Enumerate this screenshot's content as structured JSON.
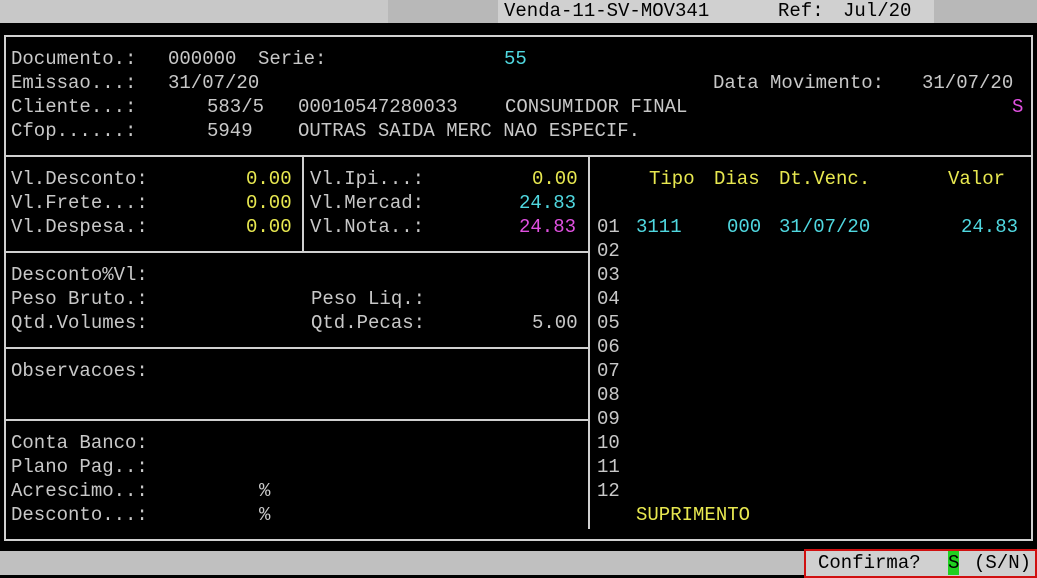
{
  "title_bar": {
    "program": "Venda-11-SV-MOV341",
    "ref_label": "Ref:",
    "ref_value": "Jul/20"
  },
  "header": {
    "documento_label": "Documento.:",
    "documento_value": "000000",
    "serie_label": "Serie:",
    "serie_value": "55",
    "emissao_label": "Emissao...:",
    "emissao_value": "31/07/20",
    "data_movimento_label": "Data Movimento:",
    "data_movimento_value": "31/07/20",
    "cliente_label": "Cliente...:",
    "cliente_code": "583/5",
    "cliente_doc": "00010547280033",
    "cliente_name": "CONSUMIDOR FINAL",
    "cliente_flag": "S",
    "cfop_label": "Cfop......:",
    "cfop_code": "5949",
    "cfop_desc": "OUTRAS SAIDA MERC NAO ESPECIF."
  },
  "values": {
    "vl_desconto_label": "Vl.Desconto:",
    "vl_desconto": "0.00",
    "vl_frete_label": "Vl.Frete...:",
    "vl_frete": "0.00",
    "vl_despesa_label": "Vl.Despesa.:",
    "vl_despesa": "0.00",
    "vl_ipi_label": "Vl.Ipi...:",
    "vl_ipi": "0.00",
    "vl_mercad_label": "Vl.Mercad:",
    "vl_mercad": "24.83",
    "vl_nota_label": "Vl.Nota..:",
    "vl_nota": "24.83"
  },
  "extra": {
    "desconto_pct_label": "Desconto%Vl:",
    "peso_bruto_label": "Peso Bruto.:",
    "peso_liq_label": "Peso Liq.:",
    "qtd_volumes_label": "Qtd.Volumes:",
    "qtd_pecas_label": "Qtd.Pecas:",
    "qtd_pecas_value": "5.00",
    "observacoes_label": "Observacoes:"
  },
  "payment": {
    "conta_banco_label": "Conta Banco:",
    "plano_pag_label": "Plano Pag..:",
    "acrescimo_label": "Acrescimo..:",
    "acrescimo_pct": "%",
    "desconto_label": "Desconto...:",
    "desconto_pct": "%"
  },
  "installments": {
    "headers": {
      "tipo": "Tipo",
      "dias": "Dias",
      "dt_venc": "Dt.Venc.",
      "valor": "Valor"
    },
    "rows": [
      {
        "n": "01",
        "tipo": "3111",
        "dias": "000",
        "dt_venc": "31/07/20",
        "valor": "24.83"
      },
      {
        "n": "02"
      },
      {
        "n": "03"
      },
      {
        "n": "04"
      },
      {
        "n": "05"
      },
      {
        "n": "06"
      },
      {
        "n": "07"
      },
      {
        "n": "08"
      },
      {
        "n": "09"
      },
      {
        "n": "10"
      },
      {
        "n": "11"
      },
      {
        "n": "12"
      }
    ],
    "footer": "SUPRIMENTO"
  },
  "prompt": {
    "label": "Confirma?",
    "answer": "S",
    "options": "(S/N)"
  },
  "colors": {
    "background": "#000000",
    "label": "#c8c8c8",
    "yellow": "#e8e850",
    "cyan": "#50d8e0",
    "magenta": "#e050e0",
    "prompt_highlight": "#20d020",
    "prompt_border": "#d01010"
  }
}
